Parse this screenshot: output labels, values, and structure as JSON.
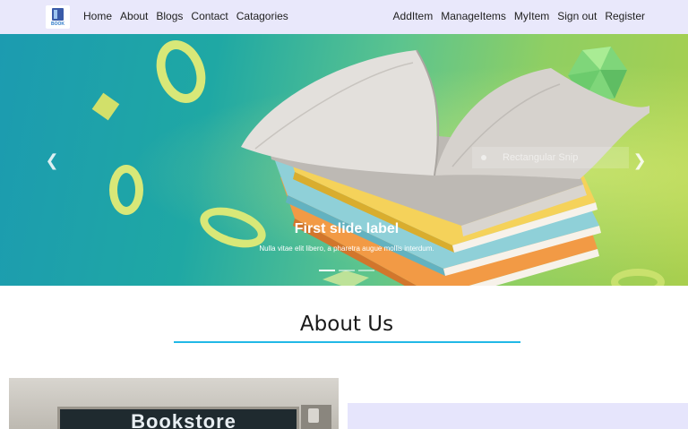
{
  "brand": {
    "logo_text": "BOOK"
  },
  "nav_left": [
    {
      "label": "Home"
    },
    {
      "label": "About"
    },
    {
      "label": "Blogs"
    },
    {
      "label": "Contact"
    },
    {
      "label": "Catagories"
    }
  ],
  "nav_right": [
    {
      "label": "AddItem"
    },
    {
      "label": "ManageItems"
    },
    {
      "label": "MyItem"
    },
    {
      "label": "Sign out"
    },
    {
      "label": "Register"
    }
  ],
  "carousel": {
    "caption_title": "First slide label",
    "caption_text": "Nulla vitae elit libero, a pharetra augue mollis interdum.",
    "overlay_snip_text": "Rectangular Snip",
    "prev_icon": "chevron-left-icon",
    "next_icon": "chevron-right-icon",
    "slide_count": 3,
    "active_slide": 1
  },
  "about": {
    "title": "About Us",
    "photo_sign_text": "Bookstore"
  },
  "colors": {
    "navbar_bg": "#e9e8fb",
    "accent_underline": "#21b8e6",
    "info_box_bg": "#e6e5fc"
  }
}
